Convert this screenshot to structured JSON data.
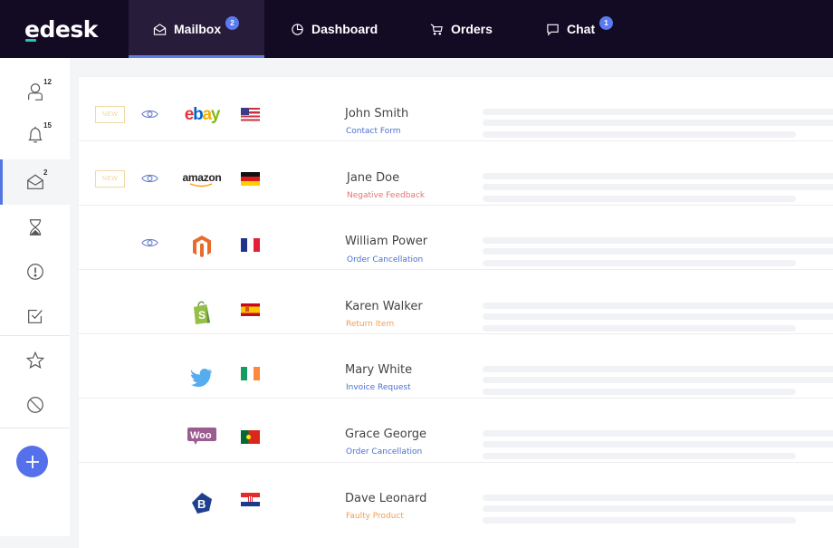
{
  "app": {
    "logo": "edesk",
    "colors": {
      "topbar": "#130a24",
      "accent": "#5b7cf0",
      "active_tab_bg": "#271d3b"
    }
  },
  "topnav": {
    "tabs": [
      {
        "label": "Mailbox",
        "icon": "envelope-open-icon",
        "badge": "2",
        "active": true
      },
      {
        "label": "Dashboard",
        "icon": "pie-chart-icon",
        "badge": null,
        "active": false
      },
      {
        "label": "Orders",
        "icon": "cart-icon",
        "badge": null,
        "active": false
      },
      {
        "label": "Chat",
        "icon": "chat-bubble-icon",
        "badge": "1",
        "active": false
      }
    ]
  },
  "sidebar": {
    "items": [
      {
        "icon": "user-icon",
        "count": "12"
      },
      {
        "icon": "bell-icon",
        "count": "15"
      },
      {
        "icon": "envelope-open-icon",
        "count": "2",
        "active": true
      },
      {
        "icon": "hourglass-icon",
        "count": ""
      },
      {
        "icon": "alert-circle-icon",
        "count": ""
      },
      {
        "icon": "checkbox-icon",
        "count": ""
      },
      {
        "icon": "star-icon",
        "count": ""
      },
      {
        "icon": "blocked-icon",
        "count": ""
      }
    ],
    "add_button": "add-icon"
  },
  "tickets": [
    {
      "is_new": true,
      "new_label": "NEW",
      "viewed": true,
      "channel": "eBay",
      "country": "United States",
      "name": "John Smith",
      "tag": "Contact Form",
      "tag_color": "#4a6fd1"
    },
    {
      "is_new": true,
      "new_label": "NEW",
      "viewed": true,
      "channel": "Amazon",
      "country": "Germany",
      "name": "Jane Doe",
      "tag": "Negative Feedback",
      "tag_color": "#e57373"
    },
    {
      "is_new": false,
      "viewed": true,
      "channel": "Magento",
      "country": "France",
      "name": "William Power",
      "tag": "Order Cancellation",
      "tag_color": "#4a6fd1"
    },
    {
      "is_new": false,
      "viewed": false,
      "channel": "Shopify",
      "country": "Spain",
      "name": "Karen Walker",
      "tag": "Return Item",
      "tag_color": "#f0a050"
    },
    {
      "is_new": false,
      "viewed": false,
      "channel": "Twitter",
      "country": "Ireland",
      "name": "Mary White",
      "tag": "Invoice Request",
      "tag_color": "#4a6fd1"
    },
    {
      "is_new": false,
      "viewed": false,
      "channel": "WooCommerce",
      "country": "Portugal",
      "name": "Grace George",
      "tag": "Order Cancellation",
      "tag_color": "#4a6fd1"
    },
    {
      "is_new": false,
      "viewed": false,
      "channel": "Bonanza",
      "country": "Croatia",
      "name": "Dave Leonard",
      "tag": "Faulty Product",
      "tag_color": "#f0a050"
    }
  ]
}
